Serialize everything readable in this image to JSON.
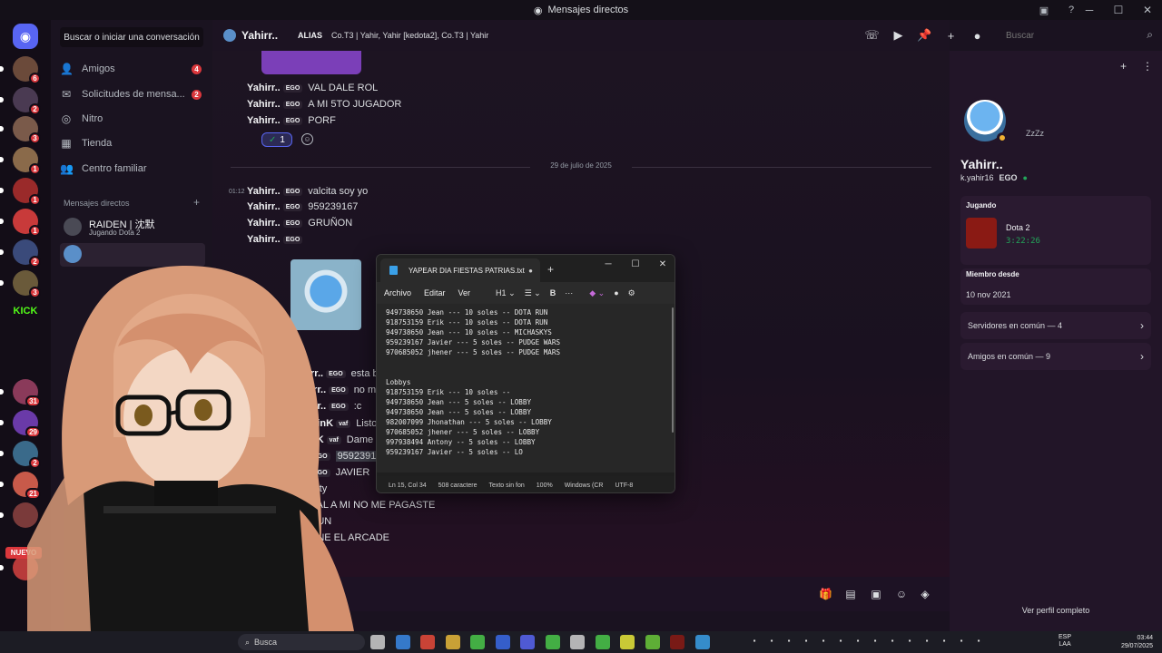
{
  "window": {
    "title": "Mensajes directos"
  },
  "colors": {
    "accent": "#5865f2",
    "danger": "#da373c",
    "online": "#23a55a",
    "idle": "#f0b232"
  },
  "rail": {
    "badges": [
      "6",
      "2",
      "3",
      "1",
      "1",
      "1",
      "2",
      "3",
      "31",
      "29",
      "2",
      "21"
    ],
    "kick_label": "KICK",
    "new_label": "NUEVO"
  },
  "dm": {
    "search": "Buscar o iniciar una conversación",
    "nav": [
      {
        "label": "Amigos",
        "icon": "friends-icon",
        "count": "4"
      },
      {
        "label": "Solicitudes de mensa...",
        "icon": "envelope-icon",
        "count": "2"
      },
      {
        "label": "Nitro",
        "icon": "nitro-icon",
        "count": ""
      },
      {
        "label": "Tienda",
        "icon": "shop-icon",
        "count": ""
      },
      {
        "label": "Centro familiar",
        "icon": "family-icon",
        "count": ""
      }
    ],
    "section_label": "Mensajes directos",
    "section_add": "+",
    "users": [
      {
        "name": "RAIDEN | 沈默",
        "activity": "Jugando Dota 2"
      }
    ]
  },
  "header": {
    "name": "Yahirr..",
    "alias_label": "ALIAS",
    "aliases": "Co.T3 | Yahir, Yahir [kedota2], Co.T3 | Yahir",
    "search_placeholder": "Buscar"
  },
  "chat": {
    "date_separator": "29 de julio de 2025",
    "reaction_count": "1",
    "messages_top": [
      {
        "user": "Yahirr..",
        "tag": "EGO",
        "text": "VAL DALE ROL"
      },
      {
        "user": "Yahirr..",
        "tag": "EGO",
        "text": "A MI 5TO JUGADOR"
      },
      {
        "user": "Yahirr..",
        "tag": "EGO",
        "text": "PORF"
      }
    ],
    "first_time": "01:12",
    "messages_day": [
      {
        "user": "Yahirr..",
        "tag": "EGO",
        "text": "valcita soy yo"
      },
      {
        "user": "Yahirr..",
        "tag": "EGO",
        "text": "959239167"
      },
      {
        "user": "Yahirr..",
        "tag": "EGO",
        "text": "GRUÑON"
      },
      {
        "user": "Yahirr..",
        "tag": "EGO",
        "text": ""
      }
    ],
    "messages_lower": [
      {
        "user": "rr..",
        "tag": "EGO",
        "text": "esta bugeado n"
      },
      {
        "user": "irr..",
        "tag": "EGO",
        "text": "no me llega al i"
      },
      {
        "user": "irr..",
        "tag": "EGO",
        "text": ":c"
      },
      {
        "user": "PinK",
        "tag": "vaf",
        "text": "Listo"
      },
      {
        "user": "nK",
        "tag": "vaf",
        "text": "Dame numero"
      },
      {
        "user": "",
        "tag": "EGO",
        "text": "959239167"
      },
      {
        "user": "",
        "tag": "EGO",
        "text": "JAVIER"
      },
      {
        "user": "o",
        "tag": "",
        "text": "ty"
      },
      {
        "user": "",
        "tag": "",
        "text": "VAL A MI NO ME PAGASTE"
      },
      {
        "user": "",
        "tag": "",
        "text": "AUN"
      },
      {
        "user": "",
        "tag": "",
        "text": "ANE EL ARCADE"
      }
    ]
  },
  "profile": {
    "status_text": "ZzZz",
    "name": "Yahirr..",
    "handle": "k.yahir16",
    "tag": "EGO",
    "playing_label": "Jugando",
    "game": "Dota 2",
    "game_time": "3:22:26",
    "member_label": "Miembro desde",
    "member_since": "10 nov 2021",
    "servers_common": "Servidores en común — 4",
    "friends_common": "Amigos en común — 9",
    "view_full": "Ver perfil completo"
  },
  "notepad": {
    "tab_title": "YAPEAR DIA FIESTAS PATRIAS.txt",
    "menu": [
      "Archivo",
      "Editar",
      "Ver"
    ],
    "heading": "H1",
    "bold": "B",
    "lines": [
      "949738650 Jean --- 10 soles -- DOTA RUN",
      "918753159 Erik --- 10 soles -- DOTA RUN",
      "949738650 Jean --- 10 soles -- MICHASKYS",
      "959239167 Javier --- 5 soles -- PUDGE WARS",
      "970685052 jhener --- 5 soles -- PUDGE MARS",
      "",
      "",
      "Lobbys",
      "918753159 Erik --- 10 soles --",
      "949738650 Jean --- 5 soles -- LOBBY",
      "949738650 Jean --- 5 soles -- LOBBY",
      "982007099 Jhonathan --- 5 soles -- LOBBY",
      "970685052 jhener --- 5 soles -- LOBBY",
      "997938494 Antony -- 5 soles -- LOBBY",
      "959239167 Javier -- 5 soles -- LO"
    ],
    "status": {
      "position": "Ln 15, Col 34",
      "chars": "508 caractere",
      "format": "Texto sin fon",
      "zoom": "100%",
      "eol": "Windows (CR",
      "encoding": "UTF-8"
    }
  },
  "taskbar": {
    "search": "Busca",
    "lang_top": "ESP",
    "lang_bottom": "LAA",
    "time": "03:44",
    "date": "29/07/2025"
  }
}
